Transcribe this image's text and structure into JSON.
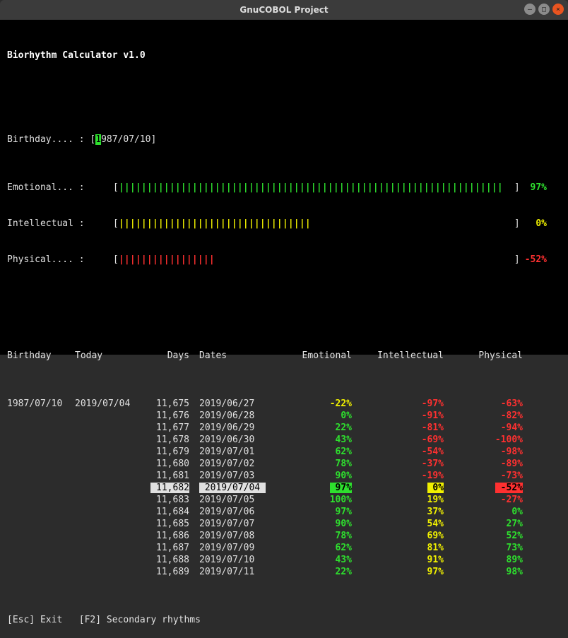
{
  "window": {
    "title": "GnuCOBOL Project"
  },
  "app": {
    "title": "Biorhythm Calculator v1.0"
  },
  "input": {
    "birthday_label": "Birthday.... : ",
    "birthday_prefix": "[",
    "birthday_cursor": "1",
    "birthday_rest": "987/07/10]"
  },
  "bars": {
    "emotional": {
      "label": "Emotional... : ",
      "open": "[",
      "close": "]",
      "value": "97%",
      "color": "bgreen",
      "fill": 68,
      "total": 70
    },
    "intellectual": {
      "label": "Intellectual : ",
      "open": "[",
      "close": "]",
      "value": "0%",
      "color": "byellow",
      "fill": 34,
      "total": 70
    },
    "physical": {
      "label": "Physical.... : ",
      "open": "[",
      "close": "]",
      "value": "-52%",
      "color": "bred",
      "fill": 17,
      "total": 70
    }
  },
  "headers": {
    "birthday": "Birthday",
    "today": "Today",
    "days": "Days",
    "dates": "Dates",
    "emotional": "Emotional",
    "intellectual": "Intellectual",
    "physical": "Physical"
  },
  "birthday_val": "1987/07/10",
  "today_val": "2019/07/04",
  "rows": [
    {
      "days": "11,675",
      "date": "2019/06/27",
      "e": "-22%",
      "eneg": true,
      "i": "-97%",
      "ineg": true,
      "p": "-63%",
      "pneg": true
    },
    {
      "days": "11,676",
      "date": "2019/06/28",
      "e": "0%",
      "eneg": false,
      "i": "-91%",
      "ineg": true,
      "p": "-82%",
      "pneg": true
    },
    {
      "days": "11,677",
      "date": "2019/06/29",
      "e": "22%",
      "eneg": false,
      "i": "-81%",
      "ineg": true,
      "p": "-94%",
      "pneg": true
    },
    {
      "days": "11,678",
      "date": "2019/06/30",
      "e": "43%",
      "eneg": false,
      "i": "-69%",
      "ineg": true,
      "p": "-100%",
      "pneg": true
    },
    {
      "days": "11,679",
      "date": "2019/07/01",
      "e": "62%",
      "eneg": false,
      "i": "-54%",
      "ineg": true,
      "p": "-98%",
      "pneg": true
    },
    {
      "days": "11,680",
      "date": "2019/07/02",
      "e": "78%",
      "eneg": false,
      "i": "-37%",
      "ineg": true,
      "p": "-89%",
      "pneg": true
    },
    {
      "days": "11,681",
      "date": "2019/07/03",
      "e": "90%",
      "eneg": false,
      "i": "-19%",
      "ineg": true,
      "p": "-73%",
      "pneg": true
    },
    {
      "days": "11,682",
      "date": "2019/07/04",
      "e": "97%",
      "eneg": false,
      "i": "0%",
      "ineg": false,
      "p": "-52%",
      "pneg": true,
      "today": true
    },
    {
      "days": "11,683",
      "date": "2019/07/05",
      "e": "100%",
      "eneg": false,
      "i": "19%",
      "ineg": false,
      "p": "-27%",
      "pneg": true
    },
    {
      "days": "11,684",
      "date": "2019/07/06",
      "e": "97%",
      "eneg": false,
      "i": "37%",
      "ineg": false,
      "p": "0%",
      "pneg": false
    },
    {
      "days": "11,685",
      "date": "2019/07/07",
      "e": "90%",
      "eneg": false,
      "i": "54%",
      "ineg": false,
      "p": "27%",
      "pneg": false
    },
    {
      "days": "11,686",
      "date": "2019/07/08",
      "e": "78%",
      "eneg": false,
      "i": "69%",
      "ineg": false,
      "p": "52%",
      "pneg": false
    },
    {
      "days": "11,687",
      "date": "2019/07/09",
      "e": "62%",
      "eneg": false,
      "i": "81%",
      "ineg": false,
      "p": "73%",
      "pneg": false
    },
    {
      "days": "11,688",
      "date": "2019/07/10",
      "e": "43%",
      "eneg": false,
      "i": "91%",
      "ineg": false,
      "p": "89%",
      "pneg": false
    },
    {
      "days": "11,689",
      "date": "2019/07/11",
      "e": "22%",
      "eneg": false,
      "i": "97%",
      "ineg": false,
      "p": "98%",
      "pneg": false
    }
  ],
  "footer": {
    "esc": "[Esc] Exit",
    "f2": "[F2] Secondary rhythms"
  }
}
